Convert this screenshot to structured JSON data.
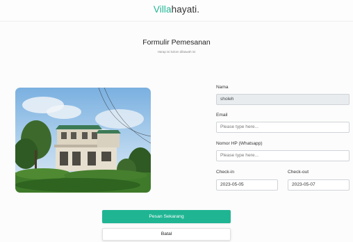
{
  "navbar": {
    "brand_accent": "Villa",
    "brand_rest": "hayati."
  },
  "form": {
    "title": "Formulir Pemesanan",
    "subtitle": "Harap isi kolom dibawah ini",
    "fields": {
      "name": {
        "label": "Nama",
        "value": "sholeh"
      },
      "email": {
        "label": "Email",
        "placeholder": "Please type here..."
      },
      "phone": {
        "label": "Nomor HP (Whatsapp)",
        "placeholder": "Please type here..."
      },
      "checkin": {
        "label": "Check-in",
        "value": "2023-05-05"
      },
      "checkout": {
        "label": "Check-out",
        "value": "2023-05-07"
      }
    },
    "submit_label": "Pesan Sekarang",
    "cancel_label": "Batal"
  },
  "colors": {
    "accent": "#1fb593",
    "disabled_field": "#e8ecef"
  },
  "icons": {
    "photo": "villa-photo"
  }
}
